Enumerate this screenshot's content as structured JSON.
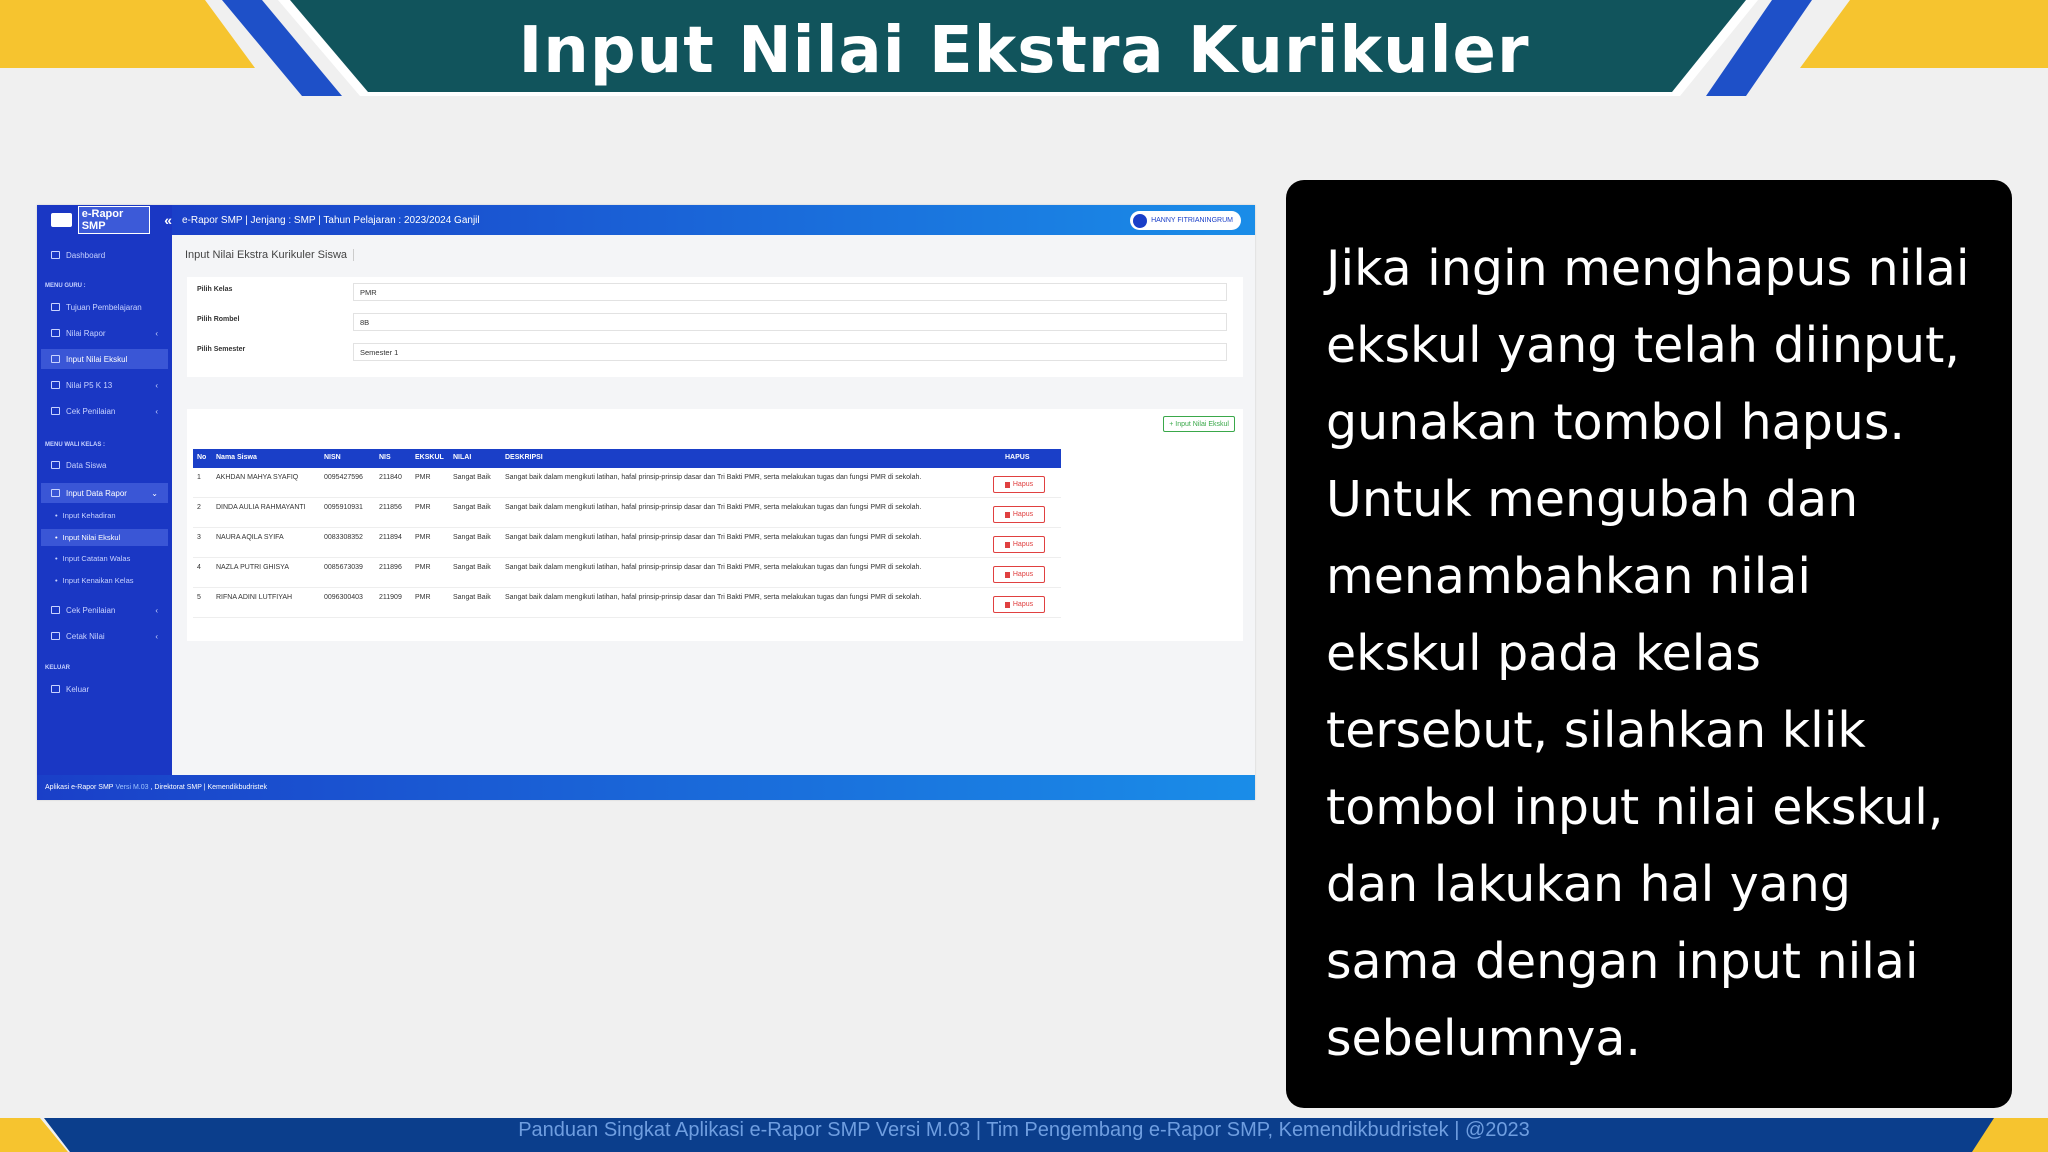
{
  "slide": {
    "title": "Input Nilai Ekstra Kurikuler",
    "footer": "Panduan Singkat Aplikasi e-Rapor SMP Versi M.03 | Tim Pengembang e-Rapor SMP, Kemendikbudristek | @2023",
    "explanation": "Jika ingin menghapus nilai ekskul yang telah diinput, gunakan tombol hapus. Untuk mengubah dan menambahkan nilai ekskul pada kelas tersebut, silahkan klik tombol input nilai ekskul, dan lakukan hal yang sama dengan input nilai sebelumnya.",
    "colors": {
      "banner": "#11545c",
      "accent_yellow": "#f6c42f",
      "accent_blue": "#1e50c8",
      "footer_bar": "#0b3e8c"
    }
  },
  "app": {
    "logo_text": "e-Rapor SMP",
    "collapse_icon": "«",
    "topbar_text": "e-Rapor SMP | Jenjang : SMP | Tahun Pelajaran : 2023/2024 Ganjil",
    "user_name": "HANNY FITRIANINGRUM",
    "sidebar": {
      "dashboard": "Dashboard",
      "section_guru": "MENU GURU :",
      "tujuan": "Tujuan Pembelajaran",
      "nilai_rapor": "Nilai Rapor",
      "input_nilai_ekskul": "Input Nilai Ekskul",
      "nilai_p5": "Nilai P5 K 13",
      "cek_penilaian": "Cek Penilaian",
      "section_wali": "MENU WALI KELAS :",
      "data_siswa": "Data Siswa",
      "input_data_rapor": "Input Data Rapor",
      "sub_kehadiran": "Input Kehadiran",
      "sub_ekskul": "Input Nilai Ekskul",
      "sub_catatan": "Input Catatan Walas",
      "sub_kenaikan": "Input Kenaikan Kelas",
      "cek_penilaian2": "Cek Penilaian",
      "cetak_nilai": "Cetak Nilai",
      "section_keluar": "KELUAR",
      "keluar": "Keluar",
      "chev": "‹",
      "chev_down": "⌄"
    },
    "page_heading": "Input Nilai Ekstra Kurikuler Siswa",
    "form": {
      "kelas_label": "Pilih Kelas",
      "kelas_value": "PMR",
      "rombel_label": "Pilih Rombel",
      "rombel_value": "8B",
      "semester_label": "Pilih Semester",
      "semester_value": "Semester 1"
    },
    "add_button": "+ Input Nilai Ekskul",
    "table": {
      "headers": {
        "no": "No",
        "nama": "Nama Siswa",
        "nisn": "NISN",
        "nis": "NIS",
        "ekskul": "EKSKUL",
        "nilai": "NILAI",
        "deskripsi": "DESKRIPSI",
        "hapus": "HAPUS"
      },
      "hapus_label": "Hapus",
      "rows": [
        {
          "no": "1",
          "nama": "AKHDAN MAHYA SYAFIQ",
          "nisn": "0095427596",
          "nis": "211840",
          "ekskul": "PMR",
          "nilai": "Sangat Baik",
          "deskripsi": "Sangat baik dalam mengikuti latihan, hafal prinsip-prinsip dasar dan Tri Bakti PMR, serta melakukan tugas dan fungsi PMR di sekolah."
        },
        {
          "no": "2",
          "nama": "DINDA AULIA RAHMAYANTI",
          "nisn": "0095910931",
          "nis": "211856",
          "ekskul": "PMR",
          "nilai": "Sangat Baik",
          "deskripsi": "Sangat baik dalam mengikuti latihan, hafal prinsip-prinsip dasar dan Tri Bakti PMR, serta melakukan tugas dan fungsi PMR di sekolah."
        },
        {
          "no": "3",
          "nama": "NAURA AQILA SYIFA",
          "nisn": "0083308352",
          "nis": "211894",
          "ekskul": "PMR",
          "nilai": "Sangat Baik",
          "deskripsi": "Sangat baik dalam mengikuti latihan, hafal prinsip-prinsip dasar dan Tri Bakti PMR, serta melakukan tugas dan fungsi PMR di sekolah."
        },
        {
          "no": "4",
          "nama": "NAZLA PUTRI GHISYA",
          "nisn": "0085673039",
          "nis": "211896",
          "ekskul": "PMR",
          "nilai": "Sangat Baik",
          "deskripsi": "Sangat baik dalam mengikuti latihan, hafal prinsip-prinsip dasar dan Tri Bakti PMR, serta melakukan tugas dan fungsi PMR di sekolah."
        },
        {
          "no": "5",
          "nama": "RIFNA ADINI LUTFIYAH",
          "nisn": "0096300403",
          "nis": "211909",
          "ekskul": "PMR",
          "nilai": "Sangat Baik",
          "deskripsi": "Sangat baik dalam mengikuti latihan, hafal prinsip-prinsip dasar dan Tri Bakti PMR, serta melakukan tugas dan fungsi PMR di sekolah."
        }
      ]
    },
    "footer_prefix": "Aplikasi e-Rapor SMP",
    "footer_version": "Versi M.03",
    "footer_suffix": ", Direktorat SMP | Kemendikbudristek"
  }
}
